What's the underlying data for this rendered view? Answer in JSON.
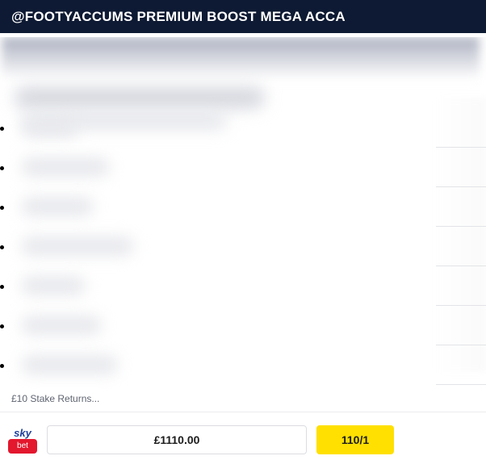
{
  "header": {
    "title": "@FOOTYACCUMS PREMIUM BOOST MEGA ACCA"
  },
  "selections": {
    "count": 7,
    "content_state": "blurred"
  },
  "stake": {
    "label": "£10 Stake Returns..."
  },
  "bet": {
    "bookmaker_logo_top": "sky",
    "bookmaker_logo_bottom": "bet",
    "returns": "£1110.00",
    "odds": "110/1"
  },
  "colors": {
    "header_bg": "#0e1a33",
    "odds_button_bg": "#ffe000",
    "logo_red": "#e3172e",
    "logo_blue": "#1f3f9a"
  }
}
